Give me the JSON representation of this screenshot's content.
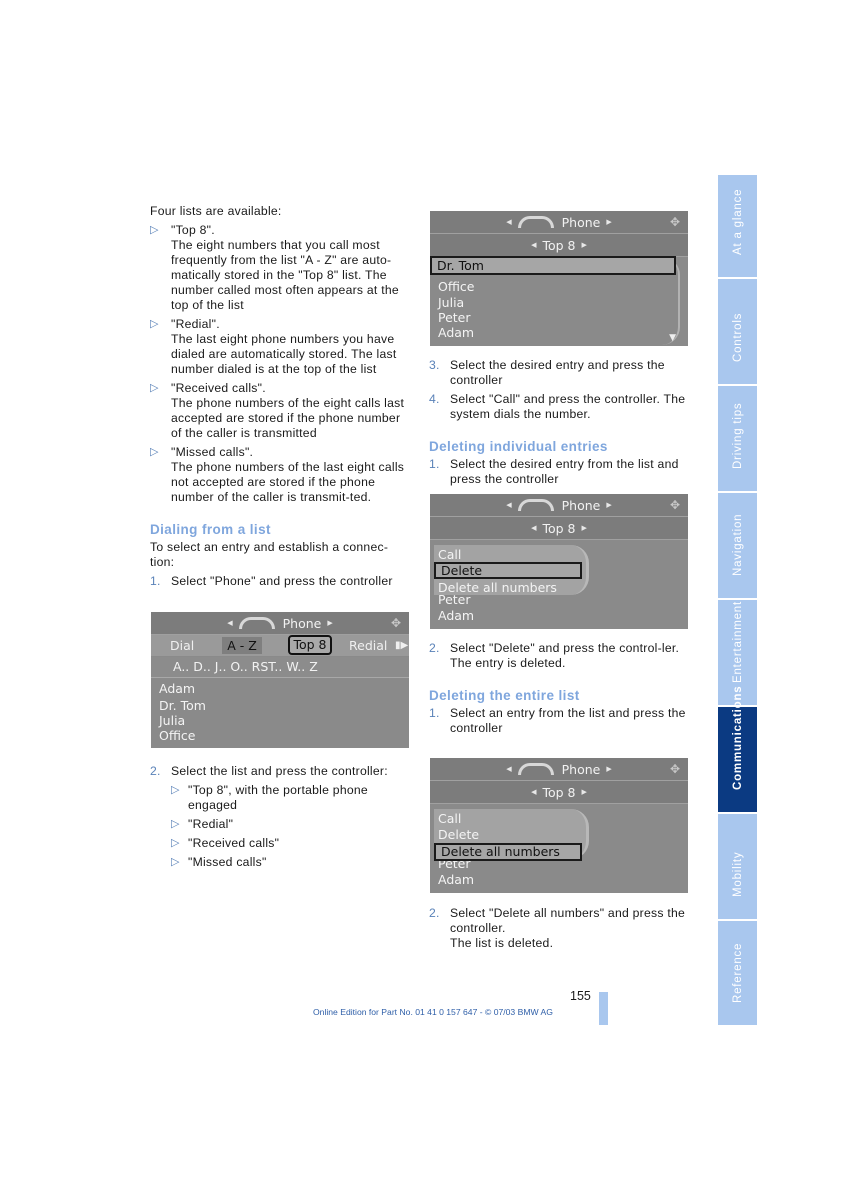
{
  "left_column": {
    "intro": "Four lists are available:",
    "list_types": [
      {
        "title": "\"Top 8\".",
        "desc": "The eight numbers that you call most frequently from the list \"A - Z\" are auto-matically stored in the \"Top 8\" list. The number called most often appears at the top of the list"
      },
      {
        "title": "\"Redial\".",
        "desc": "The last eight phone numbers you have dialed are automatically stored. The last number dialed is at the top of the list"
      },
      {
        "title": "\"Received calls\".",
        "desc": "The phone numbers of the eight calls last accepted are stored if the phone number of the caller is transmitted"
      },
      {
        "title": "\"Missed calls\".",
        "desc": "The phone numbers of the last eight calls not accepted are stored if the phone number of the caller is transmit-ted."
      }
    ],
    "section_dialing": {
      "heading": "Dialing from a list",
      "intro": "To select an entry and establish a connec-tion:",
      "step1": {
        "n": "1.",
        "text": "Select \"Phone\" and press the controller"
      },
      "step2": {
        "n": "2.",
        "text": "Select the list and press the controller:"
      },
      "step2_options": [
        "\"Top 8\", with the portable phone engaged",
        "\"Redial\"",
        "\"Received calls\"",
        "\"Missed calls\""
      ]
    }
  },
  "right_column": {
    "step3": {
      "n": "3.",
      "text": "Select the desired entry and press the controller"
    },
    "step4": {
      "n": "4.",
      "text": "Select \"Call\" and press the controller. The system dials the number."
    },
    "section_individual": {
      "heading": "Deleting individual entries",
      "step1": {
        "n": "1.",
        "text": "Select the desired entry from the list and press the controller"
      },
      "step2": {
        "n": "2.",
        "text": "Select \"Delete\" and press the control-ler.",
        "result": "The entry is deleted."
      }
    },
    "section_entire": {
      "heading": "Deleting the entire list",
      "step1": {
        "n": "1.",
        "text": "Select an entry from the list and press the controller"
      },
      "step2": {
        "n": "2.",
        "text": "Select \"Delete all numbers\" and press the controller.",
        "result": "The list is deleted."
      }
    }
  },
  "screens": {
    "phone_az": {
      "title": "Phone",
      "tabs": [
        "Dial",
        "A - Z",
        "Top 8",
        "Redial"
      ],
      "active_tab": "A - Z",
      "focused_tab": "Top 8",
      "alpha_index": "A..  D..  J..  O..  RST..  W..  Z",
      "entries": [
        "Adam",
        "Dr. Tom",
        "Julia",
        "Office"
      ]
    },
    "top8_list": {
      "title": "Phone",
      "subtitle": "Top 8",
      "selected": "Dr. Tom",
      "entries": [
        "Office",
        "Julia",
        "Peter",
        "Adam"
      ]
    },
    "delete_menu": {
      "title": "Phone",
      "subtitle": "Top 8",
      "menu": [
        "Call",
        "Delete",
        "Delete all numbers"
      ],
      "selected": "Delete",
      "entries_behind": [
        "Peter",
        "Adam"
      ]
    },
    "delete_all_menu": {
      "title": "Phone",
      "subtitle": "Top 8",
      "menu": [
        "Call",
        "Delete",
        "Delete all numbers"
      ],
      "selected": "Delete all numbers",
      "entries_behind": [
        "Peter",
        "Adam"
      ]
    }
  },
  "icons": {
    "list_bullet": "▷",
    "nav_left": "◀",
    "nav_right": "▶",
    "scroll_down": "▼",
    "controller": "✥",
    "more": "▮▶"
  },
  "side_tabs": [
    "At a glance",
    "Controls",
    "Driving tips",
    "Navigation",
    "Entertainment",
    "Communications",
    "Mobility",
    "Reference"
  ],
  "active_side_tab": "Communications",
  "page_number": "155",
  "footer": "Online Edition for Part No. 01 41 0 157 647 - © 07/03 BMW AG",
  "colors": {
    "accent_light": "#a9c7ee",
    "accent_dark": "#0b3a82",
    "heading": "#7fa6dd",
    "screen_gray": "#8a8a8a"
  }
}
